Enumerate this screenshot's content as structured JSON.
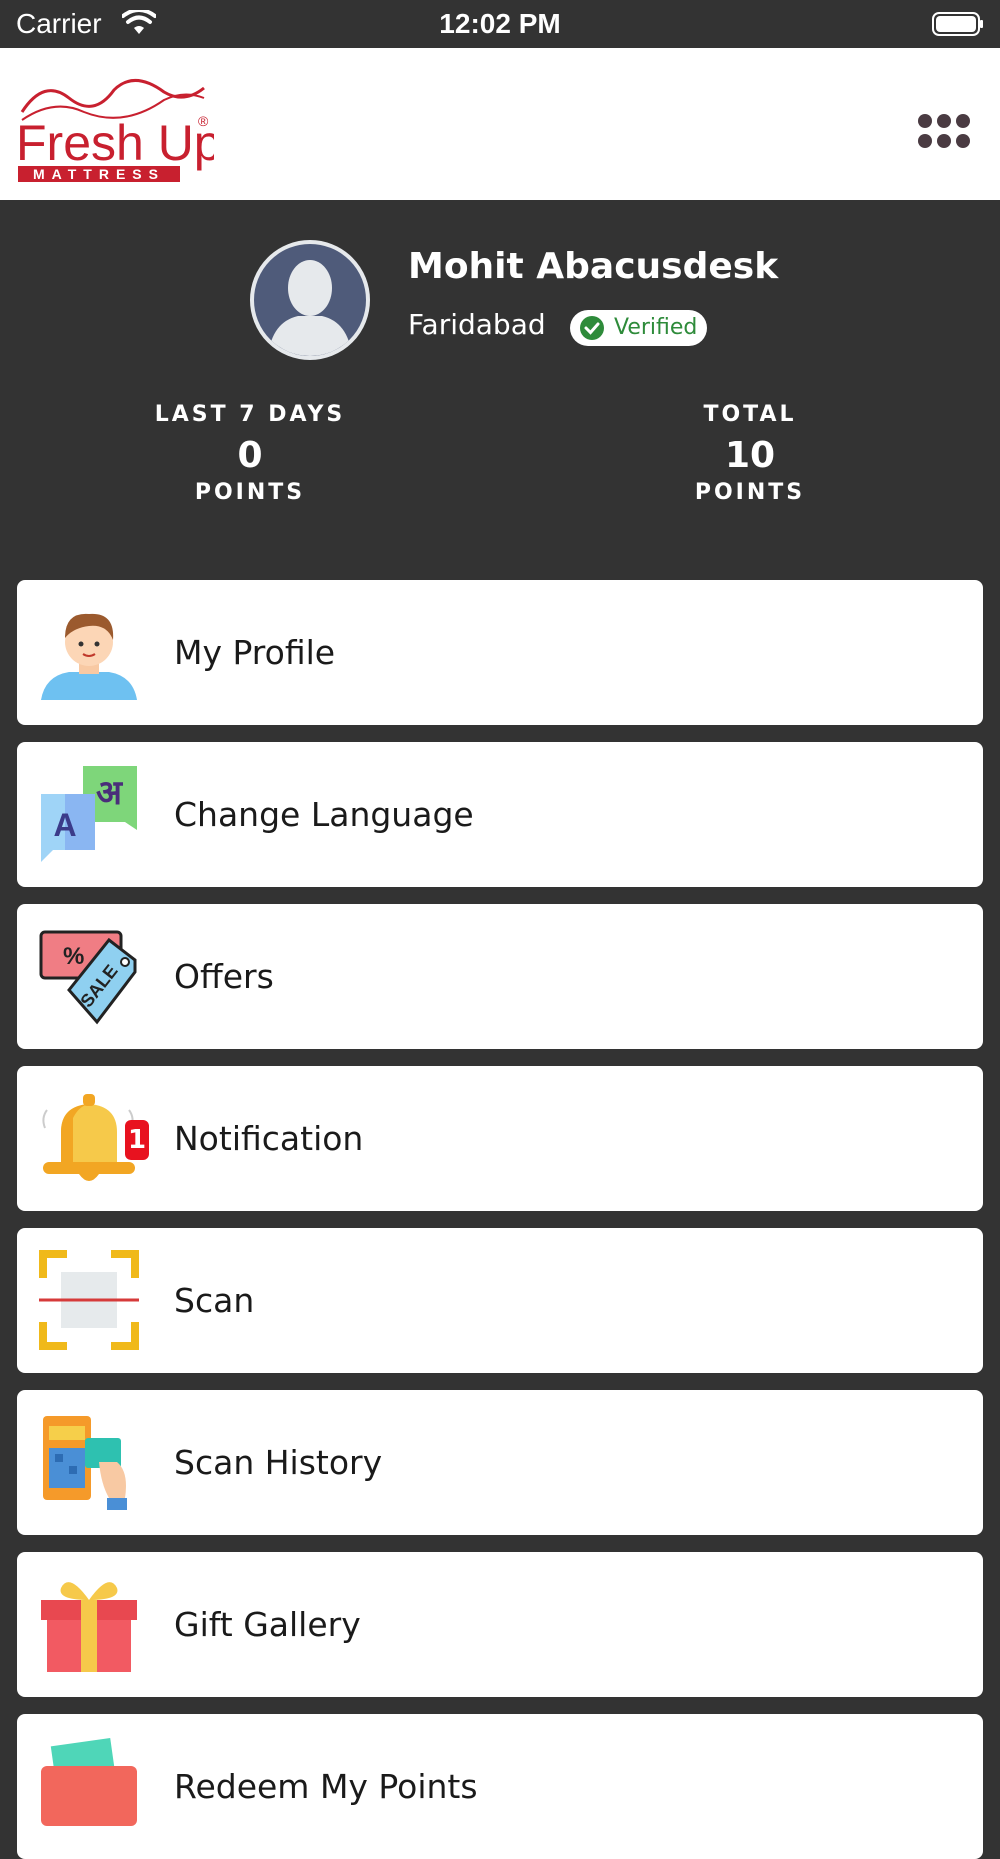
{
  "status_bar": {
    "carrier": "Carrier",
    "time": "12:02 PM"
  },
  "header": {
    "logo_text": "Fresh Up",
    "logo_subtext": "MATTRESS",
    "menu_icon": "more-dots-icon"
  },
  "profile": {
    "name": "Mohit Abacusdesk",
    "city": "Faridabad",
    "verified_label": "Verified",
    "stats": [
      {
        "label_top": "LAST 7 DAYS",
        "value": "0",
        "label_bottom": "POINTS"
      },
      {
        "label_top": "TOTAL",
        "value": "10",
        "label_bottom": "POINTS"
      }
    ]
  },
  "menu": {
    "items": [
      {
        "label": "My Profile",
        "icon": "boy-avatar-icon"
      },
      {
        "label": "Change Language",
        "icon": "language-icon"
      },
      {
        "label": "Offers",
        "icon": "sale-tag-icon"
      },
      {
        "label": "Notification",
        "icon": "bell-icon",
        "badge": "1"
      },
      {
        "label": "Scan",
        "icon": "scan-icon"
      },
      {
        "label": "Scan History",
        "icon": "card-payment-icon"
      },
      {
        "label": "Gift Gallery",
        "icon": "gift-icon"
      },
      {
        "label": "Redeem My Points",
        "icon": "wallet-icon"
      }
    ]
  },
  "colors": {
    "background": "#333333",
    "card": "#ffffff",
    "verified": "#2e8b3a",
    "brand_red": "#c8202f",
    "badge": "#e8121f"
  }
}
